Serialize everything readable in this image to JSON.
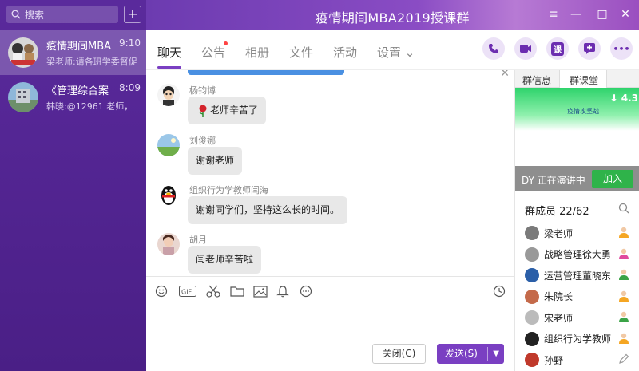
{
  "sidebar": {
    "search_placeholder": "搜索",
    "add_label": "+",
    "conversations": [
      {
        "name": "疫情期间MBA",
        "time": "9:10",
        "preview": "梁老师:请各班学委督促"
      },
      {
        "name": "《管理综合案",
        "time": "8:09",
        "preview": "韩晓:@12961 老师，"
      }
    ]
  },
  "titlebar": {
    "title": "疫情期间MBA2019授课群",
    "controls": [
      "≡",
      "—",
      "□",
      "✕"
    ]
  },
  "tabs": {
    "items": [
      "聊天",
      "公告",
      "相册",
      "文件",
      "活动",
      "设置 ⌄"
    ],
    "active": "聊天",
    "actions": {
      "phone": "phone-icon",
      "video": "video-icon",
      "class": "课",
      "add": "add-message-icon",
      "more": "•••"
    }
  },
  "messages": [
    {
      "sender": "杨钧博",
      "text": "老师辛苦了",
      "has_rose": true
    },
    {
      "sender": "刘俊娜",
      "text": "谢谢老师"
    },
    {
      "sender": "组织行为学教师闫海",
      "text": "谢谢同学们，坚持这么长的时间。"
    },
    {
      "sender": "胡月",
      "text": "闫老师辛苦啦"
    }
  ],
  "composer": {
    "close_label": "关闭(C)",
    "send_label": "发送(S)",
    "send_arrow": "▼"
  },
  "right": {
    "tabs": [
      "群信息",
      "群课堂"
    ],
    "active_tab": "群课堂",
    "video_text": "疫情攻坚战",
    "video_count": "4.3",
    "live_text": "DY 正在演讲中",
    "join_label": "加入",
    "members_title": "群成员 22/62",
    "members": [
      {
        "name": "梁老师",
        "badge_color": "#f5a623"
      },
      {
        "name": "战略管理徐大勇师",
        "badge_color": "#e04a9e"
      },
      {
        "name": "运营管理董晓东师",
        "badge_color": "#3aa346"
      },
      {
        "name": "朱院长",
        "badge_color": "#f5a623"
      },
      {
        "name": "宋老师",
        "badge_color": "#3aa346"
      },
      {
        "name": "组织行为学教师闫",
        "badge_color": "#f5a623"
      },
      {
        "name": "孙野",
        "badge_color": "#999999"
      }
    ]
  },
  "colors": {
    "accent": "#7a3fc2",
    "sidebar": "#5a2a9c",
    "join": "#2fb34a"
  }
}
